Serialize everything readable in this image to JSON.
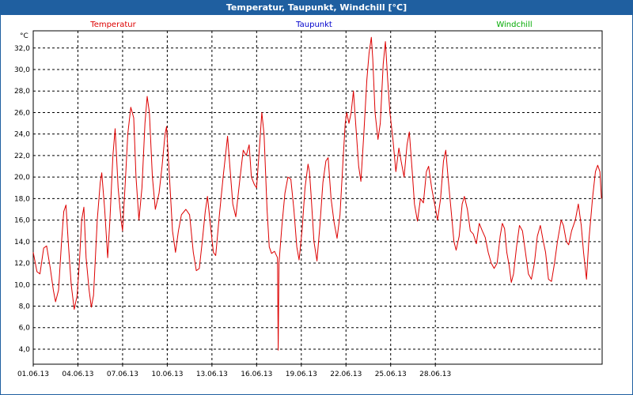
{
  "window": {
    "title": "Temperatur, Taupunkt, Windchill [°C]"
  },
  "colors": {
    "titlebar": "#1f5fa0",
    "temperatur": "#dd0000",
    "taupunkt": "#0000cc",
    "windchill": "#00aa00",
    "grid": "#000000"
  },
  "chart_data": {
    "type": "line",
    "title": "Temperatur, Taupunkt, Windchill [°C]",
    "ylabel": "°C",
    "xlabel": "",
    "ylim": [
      2.6,
      33.6
    ],
    "xlim": [
      0,
      30.75
    ],
    "grid": true,
    "legend_position": "top",
    "legend": [
      {
        "name": "Temperatur",
        "color": "#dd0000"
      },
      {
        "name": "Taupunkt",
        "color": "#0000cc"
      },
      {
        "name": "Windchill",
        "color": "#00aa00"
      }
    ],
    "y_ticks": [
      "4,0",
      "6,0",
      "8,0",
      "10,0",
      "12,0",
      "14,0",
      "16,0",
      "18,0",
      "20,0",
      "22,0",
      "24,0",
      "26,0",
      "28,0",
      "30,0",
      "32,0"
    ],
    "x_ticks": [
      "01.06.13",
      "04.06.13",
      "07.06.13",
      "10.06.13",
      "13.06.13",
      "16.06.13",
      "19.06.13",
      "22.06.13",
      "25.06.13",
      "28.06.13"
    ],
    "series": [
      {
        "name": "Temperatur",
        "color": "#dd0000",
        "x_unit": "days since 01.06.13",
        "points": [
          [
            0.0,
            13.0
          ],
          [
            0.25,
            11.2
          ],
          [
            0.45,
            11.0
          ],
          [
            0.7,
            13.4
          ],
          [
            0.9,
            13.6
          ],
          [
            1.15,
            11.5
          ],
          [
            1.35,
            9.5
          ],
          [
            1.5,
            8.4
          ],
          [
            1.7,
            9.5
          ],
          [
            1.9,
            14.0
          ],
          [
            2.05,
            16.8
          ],
          [
            2.2,
            17.4
          ],
          [
            2.35,
            14.0
          ],
          [
            2.55,
            10.0
          ],
          [
            2.75,
            7.7
          ],
          [
            2.95,
            9.0
          ],
          [
            3.1,
            12.0
          ],
          [
            3.25,
            16.0
          ],
          [
            3.4,
            17.2
          ],
          [
            3.55,
            12.5
          ],
          [
            3.75,
            9.5
          ],
          [
            3.9,
            7.9
          ],
          [
            4.05,
            9.0
          ],
          [
            4.3,
            16.0
          ],
          [
            4.5,
            19.5
          ],
          [
            4.6,
            20.4
          ],
          [
            4.8,
            17.0
          ],
          [
            5.0,
            12.5
          ],
          [
            5.15,
            16.0
          ],
          [
            5.35,
            22.0
          ],
          [
            5.5,
            24.5
          ],
          [
            5.7,
            19.0
          ],
          [
            5.9,
            16.0
          ],
          [
            6.0,
            15.0
          ],
          [
            6.2,
            20.0
          ],
          [
            6.35,
            24.0
          ],
          [
            6.55,
            26.5
          ],
          [
            6.75,
            25.5
          ],
          [
            6.9,
            20.0
          ],
          [
            7.1,
            16.0
          ],
          [
            7.3,
            19.0
          ],
          [
            7.5,
            25.0
          ],
          [
            7.65,
            27.5
          ],
          [
            7.8,
            26.0
          ],
          [
            8.0,
            20.0
          ],
          [
            8.2,
            17.0
          ],
          [
            8.45,
            18.5
          ],
          [
            8.65,
            21.0
          ],
          [
            8.85,
            24.0
          ],
          [
            8.95,
            24.7
          ],
          [
            9.15,
            20.0
          ],
          [
            9.35,
            15.0
          ],
          [
            9.55,
            13.0
          ],
          [
            9.75,
            15.0
          ],
          [
            9.95,
            16.5
          ],
          [
            10.25,
            17.0
          ],
          [
            10.5,
            16.5
          ],
          [
            10.75,
            13.0
          ],
          [
            10.95,
            11.3
          ],
          [
            11.15,
            11.5
          ],
          [
            11.35,
            14.0
          ],
          [
            11.55,
            16.8
          ],
          [
            11.7,
            18.2
          ],
          [
            11.9,
            15.5
          ],
          [
            12.1,
            13.0
          ],
          [
            12.25,
            12.7
          ],
          [
            12.5,
            16.5
          ],
          [
            12.75,
            20.0
          ],
          [
            12.95,
            22.5
          ],
          [
            13.05,
            23.8
          ],
          [
            13.2,
            21.0
          ],
          [
            13.4,
            17.5
          ],
          [
            13.6,
            16.3
          ],
          [
            13.85,
            19.5
          ],
          [
            14.1,
            22.5
          ],
          [
            14.3,
            22.0
          ],
          [
            14.5,
            23.0
          ],
          [
            14.65,
            20.0
          ],
          [
            14.85,
            19.3
          ],
          [
            15.0,
            19.0
          ],
          [
            15.15,
            22.0
          ],
          [
            15.35,
            26.0
          ],
          [
            15.5,
            24.0
          ],
          [
            15.7,
            17.0
          ],
          [
            15.85,
            13.5
          ],
          [
            16.0,
            12.9
          ],
          [
            16.2,
            13.1
          ],
          [
            16.4,
            12.5
          ],
          [
            16.45,
            3.9
          ],
          [
            16.5,
            12.0
          ],
          [
            16.7,
            15.5
          ],
          [
            16.9,
            18.5
          ],
          [
            17.1,
            20.0
          ],
          [
            17.3,
            19.8
          ],
          [
            17.5,
            17.0
          ],
          [
            17.7,
            13.5
          ],
          [
            17.85,
            12.3
          ],
          [
            18.05,
            15.0
          ],
          [
            18.25,
            19.0
          ],
          [
            18.45,
            21.2
          ],
          [
            18.55,
            20.5
          ],
          [
            18.65,
            18.5
          ],
          [
            18.85,
            14.0
          ],
          [
            19.05,
            12.2
          ],
          [
            19.25,
            15.5
          ],
          [
            19.45,
            19.5
          ],
          [
            19.65,
            21.5
          ],
          [
            19.8,
            21.8
          ],
          [
            20.0,
            18.0
          ],
          [
            20.2,
            15.8
          ],
          [
            20.4,
            14.3
          ],
          [
            20.6,
            16.5
          ],
          [
            20.8,
            21.5
          ],
          [
            20.95,
            25.0
          ],
          [
            21.05,
            26.0
          ],
          [
            21.2,
            25.0
          ],
          [
            21.35,
            26.0
          ],
          [
            21.5,
            28.0
          ],
          [
            21.65,
            25.0
          ],
          [
            21.85,
            21.0
          ],
          [
            22.0,
            19.6
          ],
          [
            22.2,
            24.0
          ],
          [
            22.4,
            29.0
          ],
          [
            22.55,
            31.5
          ],
          [
            22.7,
            33.0
          ],
          [
            22.8,
            31.0
          ],
          [
            22.95,
            26.0
          ],
          [
            23.15,
            23.5
          ],
          [
            23.3,
            25.0
          ],
          [
            23.5,
            30.5
          ],
          [
            23.65,
            32.6
          ],
          [
            23.8,
            29.0
          ],
          [
            23.95,
            26.0
          ],
          [
            24.15,
            23.5
          ],
          [
            24.35,
            20.5
          ],
          [
            24.55,
            22.7
          ],
          [
            24.7,
            21.5
          ],
          [
            24.9,
            20.0
          ],
          [
            25.1,
            23.0
          ],
          [
            25.25,
            24.2
          ],
          [
            25.45,
            20.5
          ],
          [
            25.6,
            17.5
          ],
          [
            25.8,
            15.9
          ],
          [
            26.0,
            18.0
          ],
          [
            26.2,
            17.6
          ],
          [
            26.4,
            20.5
          ],
          [
            26.55,
            21.0
          ],
          [
            26.75,
            19.0
          ],
          [
            26.95,
            17.5
          ],
          [
            27.15,
            16.0
          ],
          [
            27.35,
            18.0
          ],
          [
            27.55,
            21.5
          ],
          [
            27.7,
            22.5
          ],
          [
            27.85,
            20.0
          ],
          [
            28.05,
            17.0
          ],
          [
            28.25,
            14.0
          ],
          [
            28.4,
            13.2
          ],
          [
            28.6,
            14.5
          ],
          [
            28.8,
            17.5
          ],
          [
            28.95,
            18.2
          ],
          [
            29.15,
            17.0
          ],
          [
            29.35,
            15.0
          ],
          [
            29.55,
            14.7
          ],
          [
            29.75,
            13.8
          ],
          [
            29.95,
            15.7
          ],
          [
            30.15,
            15.0
          ],
          [
            30.35,
            14.4
          ],
          [
            30.55,
            13.0
          ],
          [
            30.75,
            12.0
          ],
          [
            30.95,
            11.5
          ],
          [
            31.15,
            12.0
          ],
          [
            31.35,
            14.5
          ],
          [
            31.5,
            15.7
          ],
          [
            31.65,
            15.2
          ],
          [
            31.8,
            13.0
          ],
          [
            31.95,
            11.8
          ],
          [
            32.1,
            10.2
          ],
          [
            32.25,
            11.0
          ],
          [
            32.45,
            13.5
          ],
          [
            32.65,
            15.5
          ],
          [
            32.85,
            15.0
          ],
          [
            33.05,
            13.0
          ],
          [
            33.25,
            11.0
          ],
          [
            33.45,
            10.5
          ],
          [
            33.65,
            12.0
          ],
          [
            33.85,
            14.5
          ],
          [
            34.05,
            15.5
          ],
          [
            34.25,
            14.0
          ],
          [
            34.4,
            13.0
          ],
          [
            34.6,
            10.5
          ],
          [
            34.8,
            10.3
          ],
          [
            35.0,
            12.0
          ],
          [
            35.2,
            14.0
          ],
          [
            35.45,
            16.0
          ],
          [
            35.6,
            15.5
          ],
          [
            35.8,
            14.0
          ],
          [
            35.95,
            13.7
          ],
          [
            36.15,
            15.0
          ],
          [
            36.4,
            16.0
          ],
          [
            36.6,
            17.5
          ],
          [
            36.8,
            15.5
          ],
          [
            36.95,
            13.0
          ],
          [
            37.15,
            10.5
          ],
          [
            37.3,
            14.0
          ],
          [
            37.55,
            18.0
          ],
          [
            37.75,
            20.5
          ],
          [
            37.9,
            21.1
          ],
          [
            38.05,
            20.5
          ],
          [
            38.15,
            18.0
          ]
        ]
      }
    ]
  }
}
